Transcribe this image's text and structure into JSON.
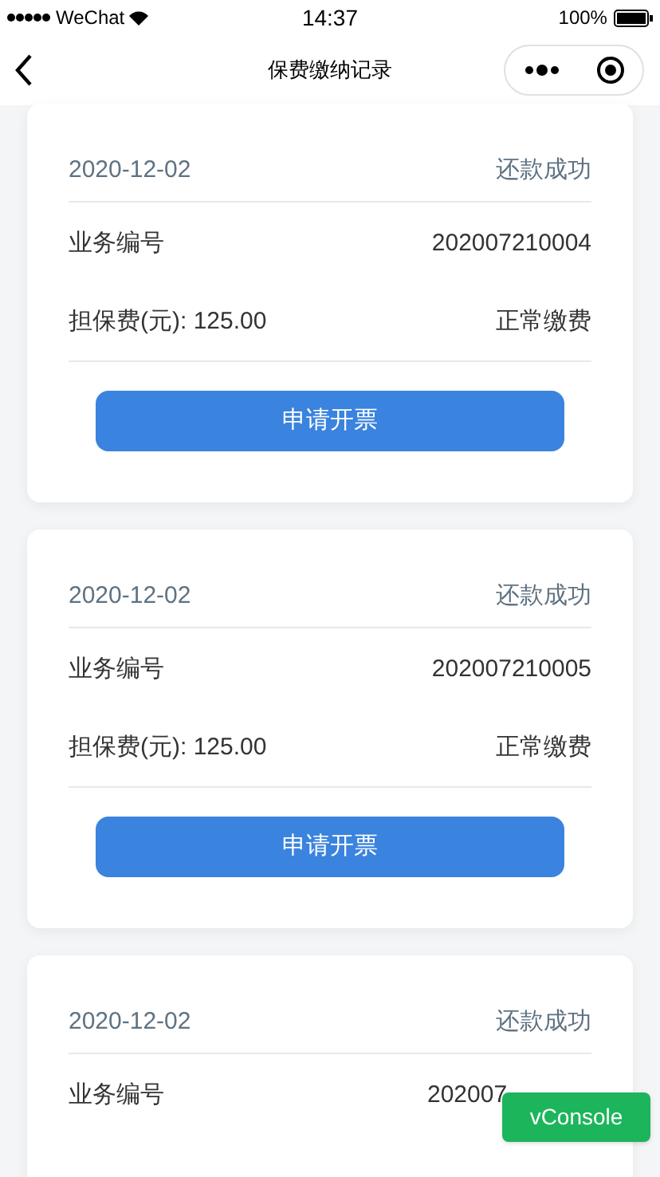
{
  "status_bar": {
    "carrier": "WeChat",
    "time": "14:37",
    "battery": "100%"
  },
  "nav": {
    "title": "保费缴纳记录"
  },
  "records": [
    {
      "date": "2020-12-02",
      "status": "还款成功",
      "number_label": "业务编号",
      "number": "202007210004",
      "fee": "担保费(元): 125.00",
      "fee_type": "正常缴费",
      "button": "申请开票"
    },
    {
      "date": "2020-12-02",
      "status": "还款成功",
      "number_label": "业务编号",
      "number": "202007210005",
      "fee": "担保费(元): 125.00",
      "fee_type": "正常缴费",
      "button": "申请开票"
    },
    {
      "date": "2020-12-02",
      "status": "还款成功",
      "number_label": "业务编号",
      "number": "202007"
    }
  ],
  "vconsole": "vConsole"
}
